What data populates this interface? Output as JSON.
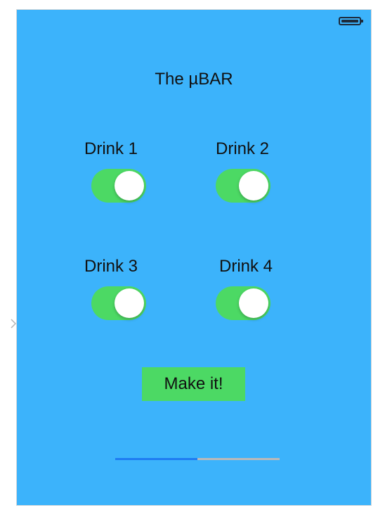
{
  "app": {
    "title": "The µBAR"
  },
  "drinks": [
    {
      "label": "Drink 1",
      "on": true
    },
    {
      "label": "Drink 2",
      "on": true
    },
    {
      "label": "Drink 3",
      "on": true
    },
    {
      "label": "Drink 4",
      "on": true
    }
  ],
  "actions": {
    "make_label": "Make it!"
  },
  "progress": {
    "value": 0.5
  },
  "colors": {
    "background": "#3cb3fb",
    "toggle_on": "#4cd964",
    "button_bg": "#4cd964",
    "progress_fill": "#1e7cf2",
    "progress_track": "#b9b9b9"
  },
  "icons": {
    "battery": "battery-icon",
    "side_chevron": "chevron-right-icon"
  }
}
